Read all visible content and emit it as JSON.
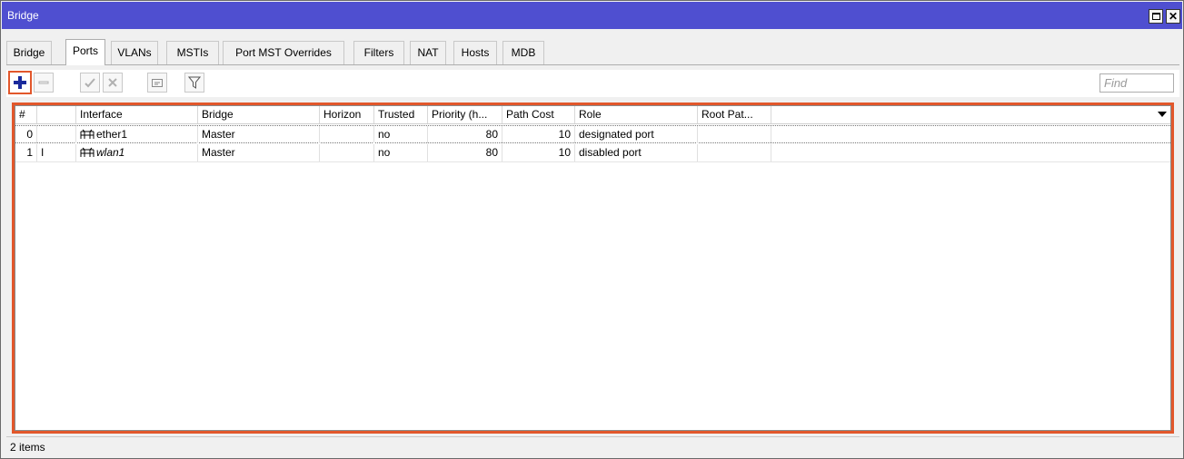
{
  "window": {
    "title": "Bridge"
  },
  "tabs": [
    {
      "label": "Bridge"
    },
    {
      "label": "Ports",
      "active": true
    },
    {
      "label": "VLANs"
    },
    {
      "label": "MSTIs"
    },
    {
      "label": "Port MST Overrides"
    },
    {
      "label": "Filters"
    },
    {
      "label": "NAT"
    },
    {
      "label": "Hosts"
    },
    {
      "label": "MDB"
    }
  ],
  "toolbar": {
    "buttons": [
      "add-icon",
      "remove-icon",
      "enable-icon",
      "disable-icon",
      "comment-icon",
      "filter-icon"
    ],
    "find_placeholder": "Find"
  },
  "table": {
    "columns": [
      "#",
      "",
      "Interface",
      "Bridge",
      "Horizon",
      "Trusted",
      "Priority (h...",
      "Path Cost",
      "Role",
      "Root Pat..."
    ],
    "rows": [
      {
        "num": "0",
        "flag": "",
        "interface": "ether1",
        "bridge": "Master",
        "horizon": "",
        "trusted": "no",
        "priority": "80",
        "path_cost": "10",
        "role": "designated port",
        "root_path": ""
      },
      {
        "num": "1",
        "flag": "I",
        "interface": "wlan1",
        "bridge": "Master",
        "horizon": "",
        "trusted": "no",
        "priority": "80",
        "path_cost": "10",
        "role": "disabled port",
        "root_path": ""
      }
    ]
  },
  "status": {
    "text": "2 items"
  },
  "colors": {
    "titlebar": "#4f4fd0",
    "highlight": "#e2572b",
    "add_icon": "#1a2a9c"
  }
}
